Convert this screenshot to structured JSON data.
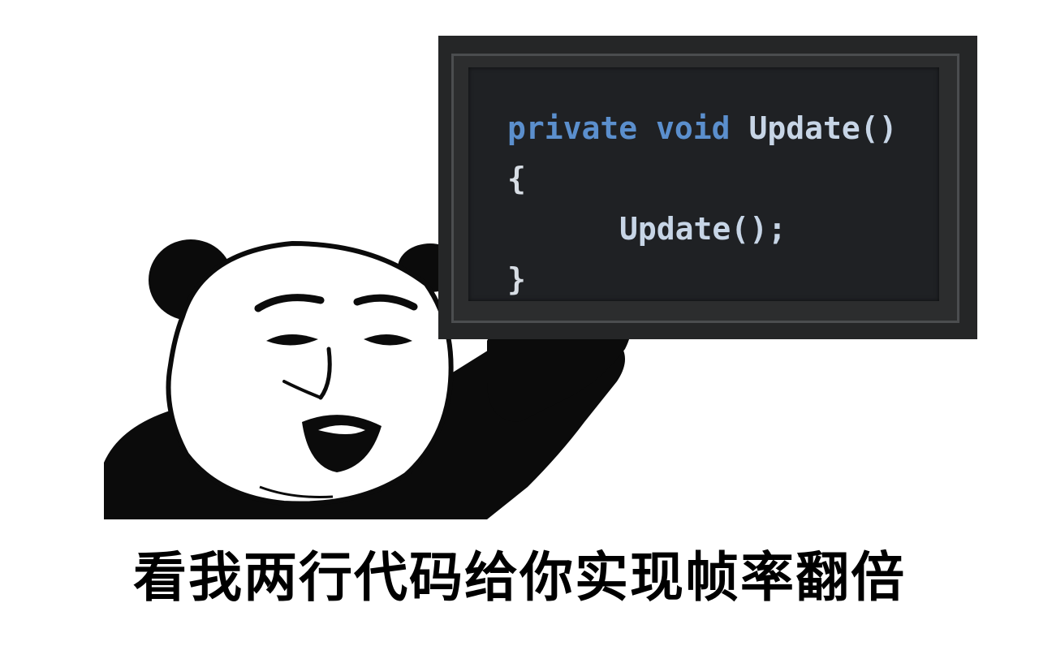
{
  "sign": {
    "code": {
      "line1_keyword1": "private",
      "line1_keyword2": "void",
      "line1_function": "Update()",
      "line2": "{",
      "line3": "Update();",
      "line4": "}"
    }
  },
  "caption": {
    "text": "看我两行代码给你实现帧率翻倍"
  },
  "colors": {
    "keyword": "#5b8fcd",
    "identifier": "#c7d5e6",
    "sign_background": "#252627",
    "caption": "#000000"
  }
}
